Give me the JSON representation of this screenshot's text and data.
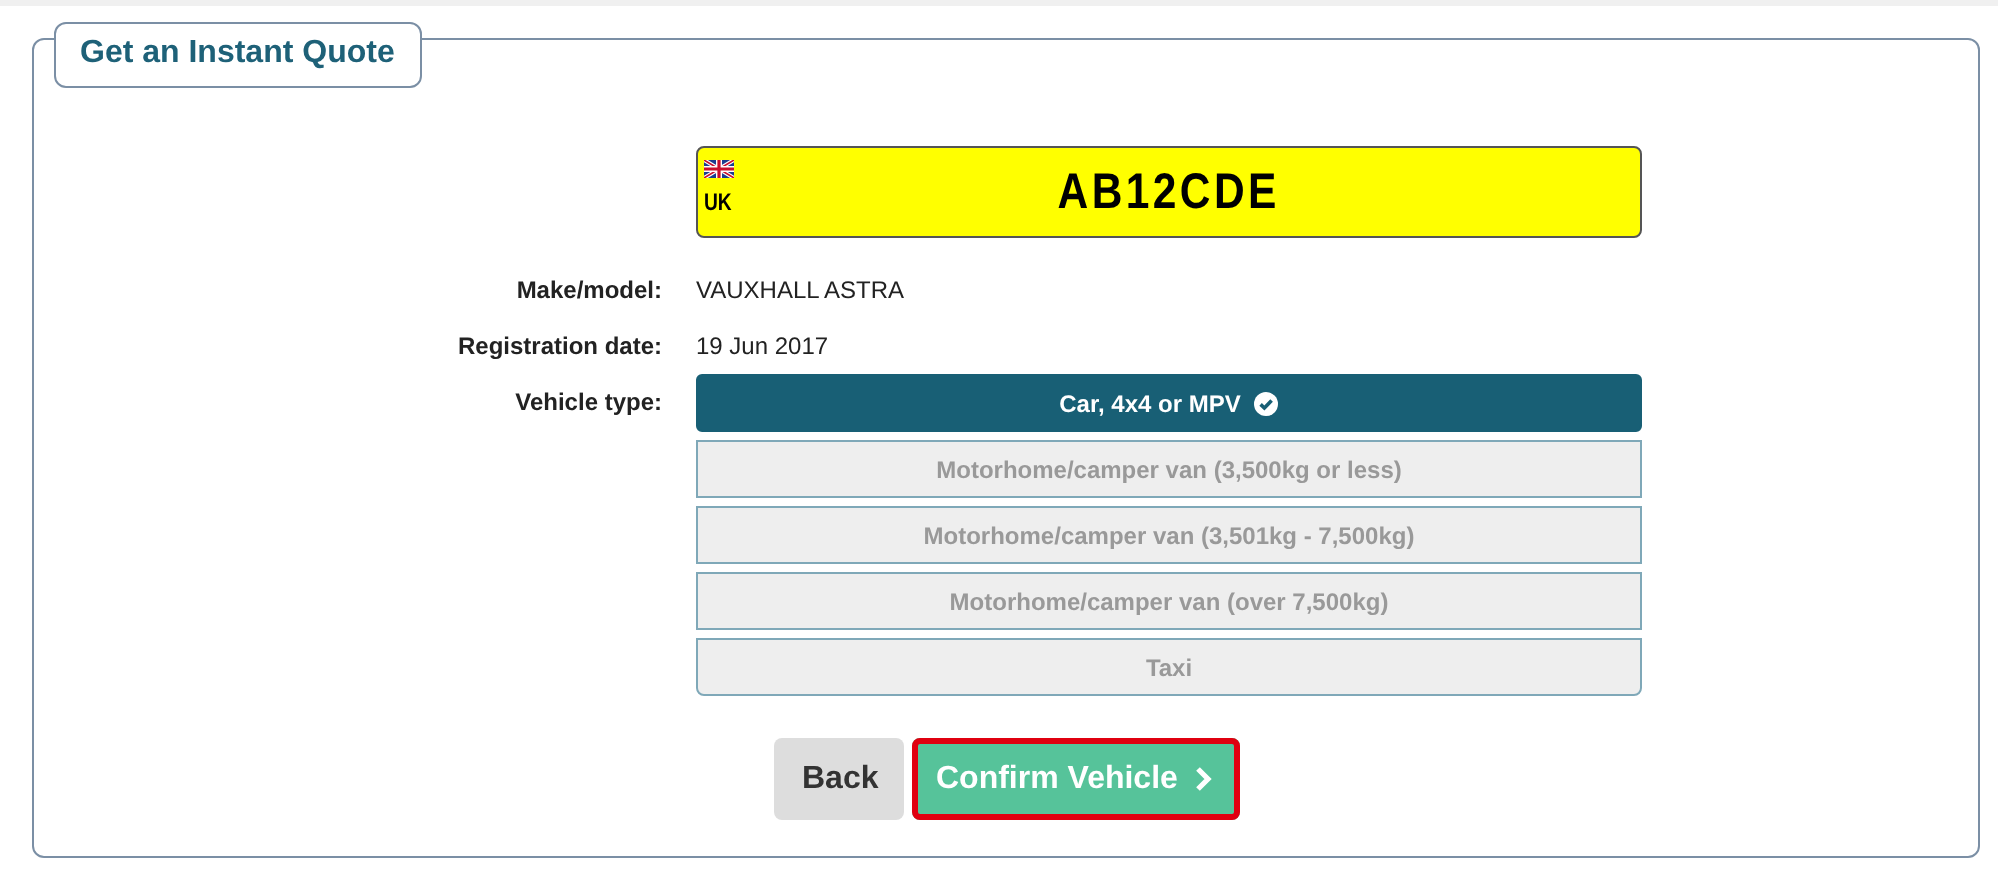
{
  "panel": {
    "title": "Get an Instant Quote"
  },
  "plate": {
    "country": "UK",
    "registration": "AB12CDE"
  },
  "details": [
    {
      "label": "Make/model:",
      "value": "VAUXHALL ASTRA"
    },
    {
      "label": "Registration date:",
      "value": "19 Jun 2017"
    }
  ],
  "vehicle_type": {
    "label": "Vehicle type:",
    "options": [
      {
        "label": "Car, 4x4 or MPV",
        "selected": true
      },
      {
        "label": "Motorhome/camper van (3,500kg or less)",
        "selected": false
      },
      {
        "label": "Motorhome/camper van (3,501kg - 7,500kg)",
        "selected": false
      },
      {
        "label": "Motorhome/camper van (over 7,500kg)",
        "selected": false
      },
      {
        "label": "Taxi",
        "selected": false
      }
    ]
  },
  "buttons": [
    {
      "kind": "back",
      "label": "Back",
      "focused": false
    },
    {
      "kind": "confirm",
      "label": "Confirm Vehicle",
      "focused": true
    }
  ]
}
